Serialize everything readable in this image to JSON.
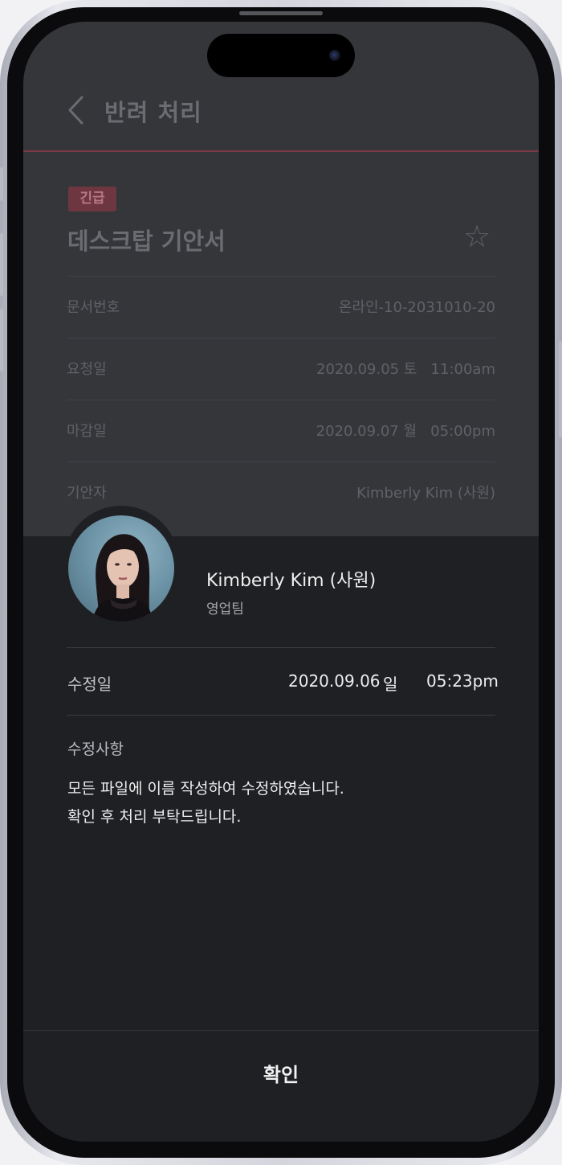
{
  "header": {
    "title": "반려 처리"
  },
  "document": {
    "badge": "긴급",
    "title": "데스크탑 기안서",
    "fields": [
      {
        "label": "문서번호",
        "value": "온라인-10-2031010-20"
      },
      {
        "label": "요청일",
        "value": "2020.09.05 토   11:00am"
      },
      {
        "label": "마감일",
        "value": "2020.09.07 월   05:00pm"
      },
      {
        "label": "기안자",
        "value": "Kimberly Kim (사원)"
      }
    ]
  },
  "profile": {
    "name": "Kimberly Kim (사원)",
    "team": "영업팀"
  },
  "modified": {
    "label": "수정일",
    "date": "2020.09.06",
    "day": "일",
    "time": "05:23pm"
  },
  "changes": {
    "label": "수정사항",
    "lines": [
      "모든 파일에 이름 작성하여 수정하였습니다.",
      "확인 후 처리 부탁드립니다."
    ]
  },
  "footer": {
    "confirm_label": "확인"
  },
  "colors": {
    "accent": "#6e3640",
    "background": "#1f2023",
    "dimmed_page": "#35363a"
  }
}
